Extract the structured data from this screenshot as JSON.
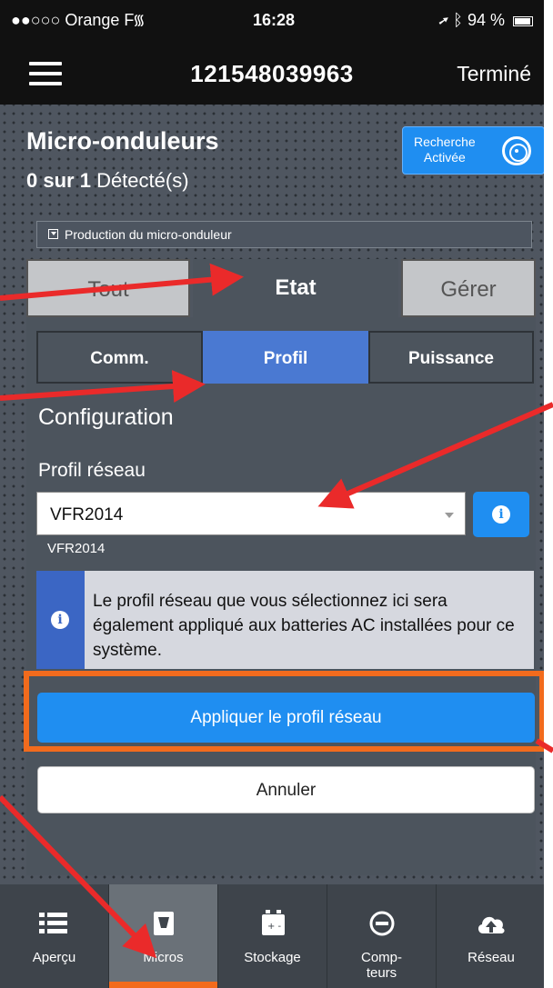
{
  "status_bar": {
    "carrier": "●●○○○ Orange F",
    "time": "16:28",
    "battery": "94 %"
  },
  "nav": {
    "title": "121548039963",
    "done": "Terminé"
  },
  "header": {
    "title": "Micro-onduleurs",
    "detected_count": "0 sur 1",
    "detected_label": "Détecté(s)",
    "search_button": "Recherche\nActivée"
  },
  "production_bar": "Production du micro-onduleur",
  "main_tabs": [
    "Tout",
    "Etat",
    "Gérer"
  ],
  "sub_tabs": [
    "Comm.",
    "Profil",
    "Puissance"
  ],
  "config": {
    "title": "Configuration",
    "profile_label": "Profil réseau",
    "profile_value": "VFR2014",
    "profile_caption": "VFR2014",
    "note": "Le profil réseau que vous sélectionnez ici sera également appliqué aux batteries AC installées pour ce système.",
    "apply_button": "Appliquer le profil réseau",
    "cancel_button": "Annuler"
  },
  "tabbar": {
    "items": [
      {
        "label": "Aperçu",
        "icon": "list-icon"
      },
      {
        "label": "Micros",
        "icon": "microinverter-icon",
        "active": true
      },
      {
        "label": "Stockage",
        "icon": "battery-storage-icon"
      },
      {
        "label": "Comp-\nteurs",
        "icon": "meter-icon"
      },
      {
        "label": "Réseau",
        "icon": "cloud-upload-icon"
      }
    ]
  },
  "colors": {
    "accent_blue": "#1f8ef1",
    "profile_tab": "#4a79d2",
    "highlight_orange": "#f26b1d",
    "arrow_red": "#ea2a2a"
  }
}
